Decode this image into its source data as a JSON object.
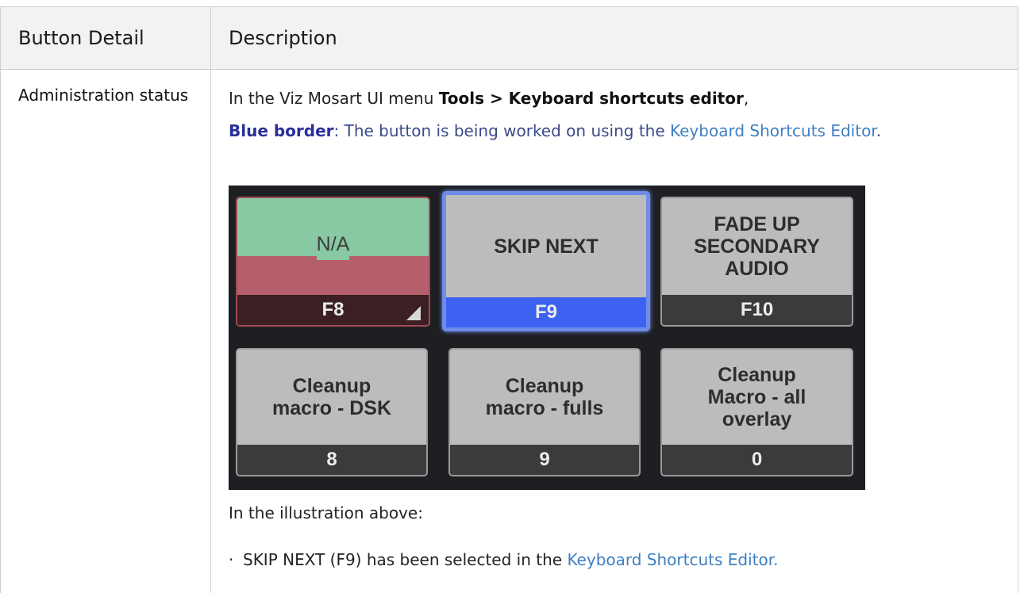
{
  "table": {
    "headers": [
      "Button Detail",
      "Description"
    ],
    "row": {
      "detail": "Administration status",
      "menu_prefix": "In the Viz Mosart UI menu ",
      "menu_path": "Tools > Keyboard shortcuts editor",
      "menu_suffix": ",",
      "blue_label": "Blue border",
      "blue_text": ": The button is being worked on using the ",
      "editor_link": "Keyboard Shortcuts Editor",
      "period": ".",
      "after_illustration": "In the illustration above:",
      "bullet_text": "SKIP NEXT (F9) has been selected in the ",
      "bullet_link": "Keyboard Shortcuts Editor."
    }
  },
  "illustration": {
    "buttons": [
      {
        "label": "N/A",
        "key": "F8",
        "state": "na"
      },
      {
        "label": "SKIP NEXT",
        "key": "F9",
        "state": "selected"
      },
      {
        "label": "FADE UP\nSECONDARY\nAUDIO",
        "key": "F10",
        "state": "normal"
      },
      {
        "label": "Cleanup\nmacro - DSK",
        "key": "8",
        "state": "normal"
      },
      {
        "label": "Cleanup\nmacro - fulls",
        "key": "9",
        "state": "normal"
      },
      {
        "label": "Cleanup\nMacro - all\noverlay",
        "key": "0",
        "state": "normal"
      }
    ],
    "colors": {
      "background": "#1e1f23",
      "button": "#bcbcbc",
      "key_bar": "#3b3b3b",
      "selected_border": "#6f8de8",
      "selected_key": "#3d62f2",
      "na_green": "#88c8a2",
      "na_red": "#b55f6c"
    }
  }
}
